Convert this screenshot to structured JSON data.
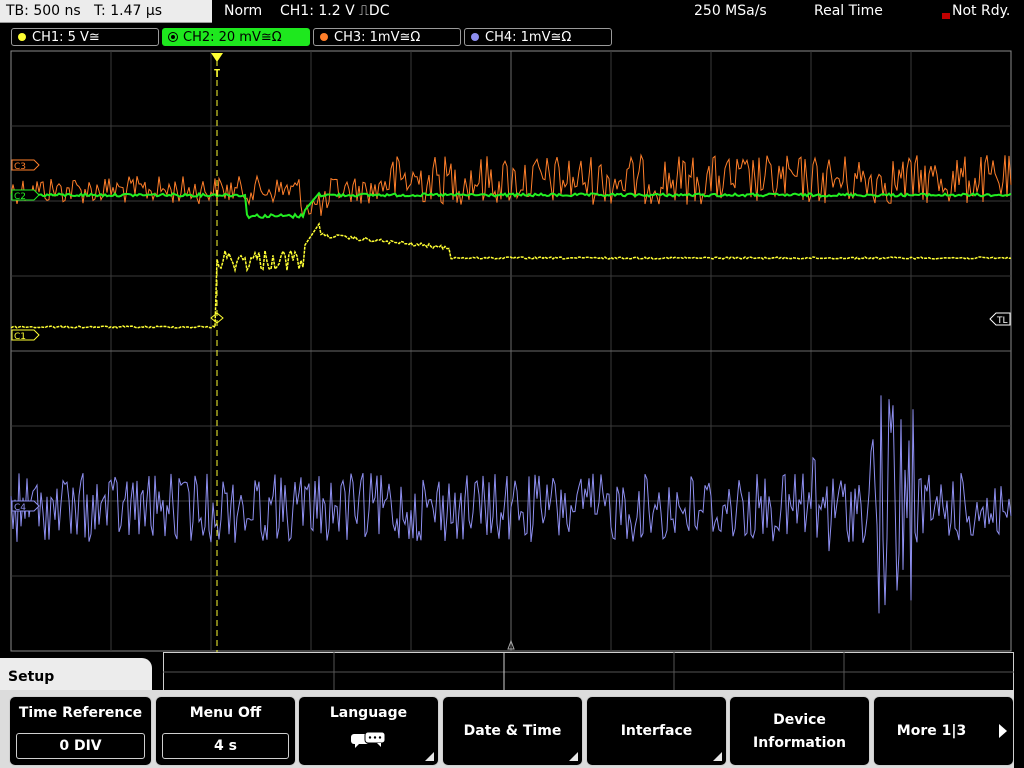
{
  "status": {
    "timebase": "TB: 500 ns",
    "trigger_time": "T: 1.47 µs",
    "trigger_mode": "Norm",
    "trigger_source": "CH1: 1.2 V ⎍DC",
    "sample_rate": "250 MSa/s",
    "acq_mode": "Real Time",
    "trigger_state": "Not Rdy."
  },
  "channels": [
    {
      "label": "CH1: 5 V≅",
      "color": "#ffff33"
    },
    {
      "label": "CH2: 20 mV≅Ω",
      "color": "#22ee22"
    },
    {
      "label": "CH3: 1mV≅Ω",
      "color": "#ff7f2a"
    },
    {
      "label": "CH4: 1mV≅Ω",
      "color": "#8e8ff0"
    }
  ],
  "markers": {
    "c3": "C3",
    "c2": "C2",
    "c1": "C1",
    "c4": "C4",
    "trigger_level": "TL",
    "trigger_pos": "T"
  },
  "menu": {
    "title": "Setup",
    "softkeys": [
      {
        "label": "Time Reference",
        "value": "0 DIV"
      },
      {
        "label": "Menu Off",
        "value": "4 s"
      },
      {
        "label": "Language",
        "icon": "speech-bubbles-icon"
      },
      {
        "label": "Date & Time"
      },
      {
        "label": "Interface"
      },
      {
        "label_line1": "Device",
        "label_line2": "Information"
      },
      {
        "label": "More 1|3"
      }
    ]
  },
  "colors": {
    "grid": "#3a3a3a",
    "background": "#000000",
    "ch1": "#ffff33",
    "ch2": "#22ee22",
    "ch3": "#ff7f2a",
    "ch4": "#8e8ff0"
  }
}
